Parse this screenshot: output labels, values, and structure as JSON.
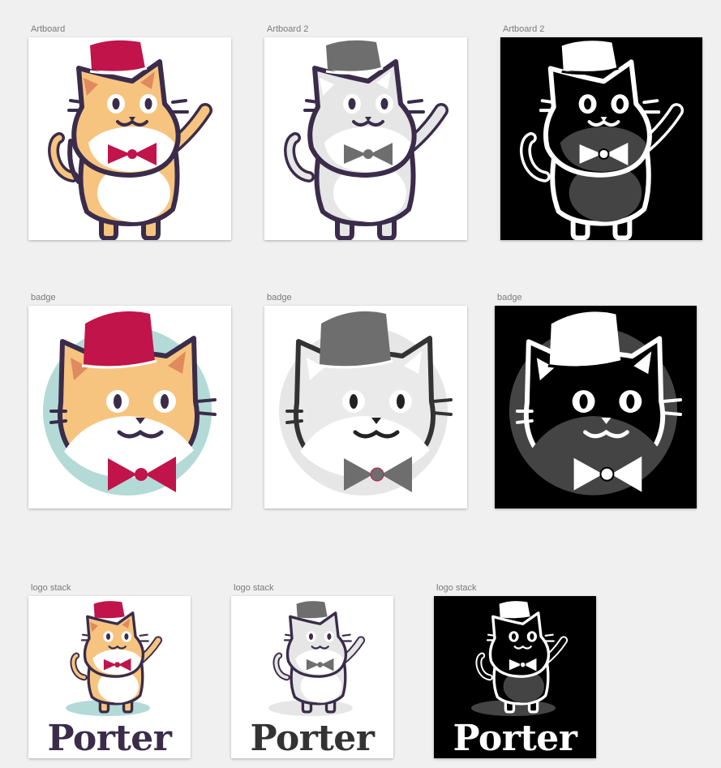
{
  "rows": [
    {
      "label": "Artboard",
      "artboards": [
        {
          "label": "Artboard",
          "variant": "color"
        },
        {
          "label": "Artboard 2",
          "variant": "grayscale"
        },
        {
          "label": "Artboard 2",
          "variant": "inverted"
        }
      ]
    },
    {
      "label": "badge",
      "artboards": [
        {
          "label": "badge",
          "variant": "color"
        },
        {
          "label": "badge",
          "variant": "grayscale"
        },
        {
          "label": "badge",
          "variant": "inverted"
        }
      ]
    },
    {
      "label": "logo stack",
      "artboards": [
        {
          "label": "logo stack",
          "variant": "color",
          "wordmark": "Porter"
        },
        {
          "label": "logo stack",
          "variant": "grayscale",
          "wordmark": "Porter"
        },
        {
          "label": "logo stack",
          "variant": "inverted",
          "wordmark": "Porter"
        }
      ]
    }
  ],
  "palette": {
    "canvas": "#f0f0f0",
    "label_gray": "#7a7a7a",
    "fez_red": "#c0144a",
    "fur_orange": "#f6c47f",
    "ear_inner": "#e08a5e",
    "outline_purple": "#3a2c4a",
    "badge_teal": "#b3dad6",
    "wordmark_purple": "#3a2c4a",
    "gray_fez": "#6e6e6e",
    "gray_body": "#e6e6e6",
    "inverted_bg": "#000000",
    "inverted_belly": "#444444"
  }
}
